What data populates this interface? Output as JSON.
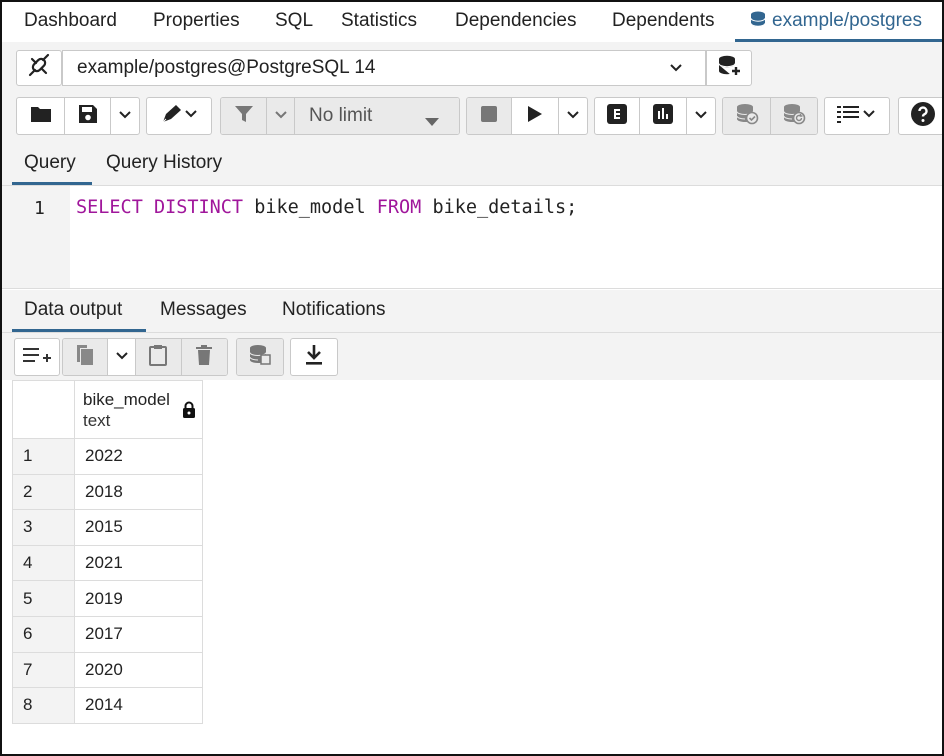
{
  "top_tabs": [
    "Dashboard",
    "Properties",
    "SQL",
    "Statistics",
    "Dependencies",
    "Dependents",
    "example/postgres"
  ],
  "connection": {
    "label": "example/postgres@PostgreSQL 14"
  },
  "toolbar": {
    "limit_label": "No limit"
  },
  "query_tabs": [
    "Query",
    "Query History"
  ],
  "editor": {
    "line_number": "1",
    "kw_select": "SELECT",
    "kw_distinct": "DISTINCT",
    "column": "bike_model",
    "kw_from": "FROM",
    "table": "bike_details;"
  },
  "output_tabs": [
    "Data output",
    "Messages",
    "Notifications"
  ],
  "grid": {
    "column_name": "bike_model",
    "column_type": "text",
    "rows": [
      {
        "n": "1",
        "v": "2022"
      },
      {
        "n": "2",
        "v": "2018"
      },
      {
        "n": "3",
        "v": "2015"
      },
      {
        "n": "4",
        "v": "2021"
      },
      {
        "n": "5",
        "v": "2019"
      },
      {
        "n": "6",
        "v": "2017"
      },
      {
        "n": "7",
        "v": "2020"
      },
      {
        "n": "8",
        "v": "2014"
      }
    ]
  },
  "colors": {
    "accent": "#326690",
    "keyword": "#a0169b"
  }
}
